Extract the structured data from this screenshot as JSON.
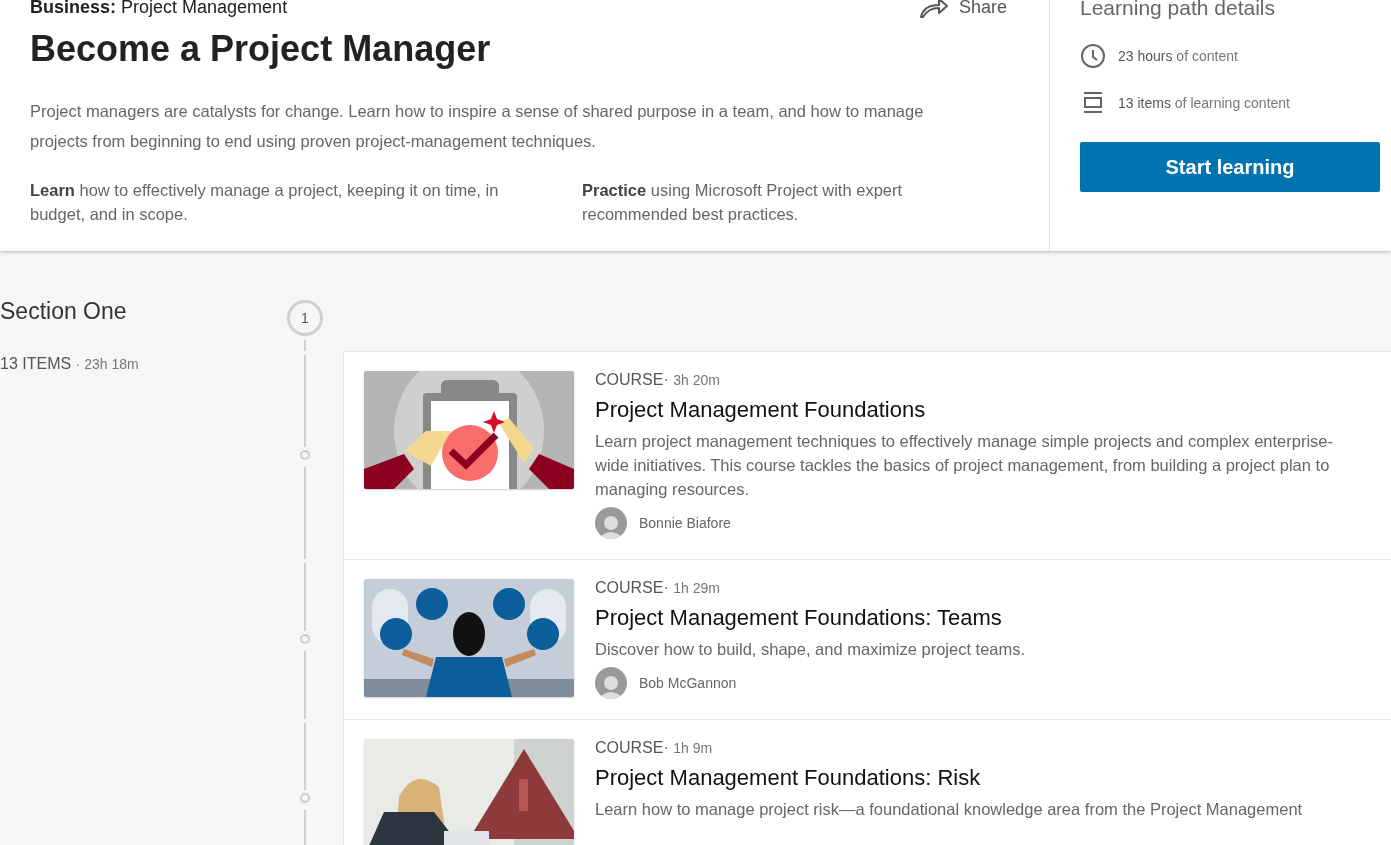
{
  "header": {
    "category_label": "Business:",
    "category": "Project Management",
    "title": "Become a Project Manager",
    "share": "Share",
    "description": "Project managers are catalysts for change. Learn how to inspire a sense of shared purpose in a team, and how to manage projects from beginning to end using proven project-management techniques.",
    "highlights": [
      "**Learn** how to effectively manage a project, keeping it on time, in budget, and in scope.",
      "**Practice** using Microsoft Project with expert recommended best practices."
    ]
  },
  "details": {
    "title": "Learning path details",
    "facts": [
      {
        "kind": "time",
        "text": "**23 hours** of content"
      },
      {
        "kind": "items",
        "text": "**13 items** of learning content"
      }
    ],
    "button": "Start learning"
  },
  "section": {
    "title": "Section One",
    "count": "13 ITEMS",
    "duration": "· 23h 18m",
    "number": "1",
    "courses": [
      {
        "kind": "course",
        "type": "COURSE·",
        "duration": "3h 20m",
        "title": "Project Management Foundations",
        "description": "Learn project management techniques to effectively manage simple projects and complex enterprise-wide initiatives. This course tackles the basics of project management, from building a project plan to managing resources.",
        "author": "Bonnie Biafore"
      },
      {
        "kind": "course",
        "type": "COURSE·",
        "duration": "1h 29m",
        "title": "Project Management Foundations: Teams",
        "description": "Discover how to build, shape, and maximize project teams.",
        "author": "Bob McGannon"
      },
      {
        "kind": "course",
        "type": "COURSE·",
        "duration": "1h 9m",
        "title": "Project Management Foundations: Risk",
        "description": "Learn how to manage project risk—a foundational knowledge area from the Project Management"
      }
    ]
  }
}
